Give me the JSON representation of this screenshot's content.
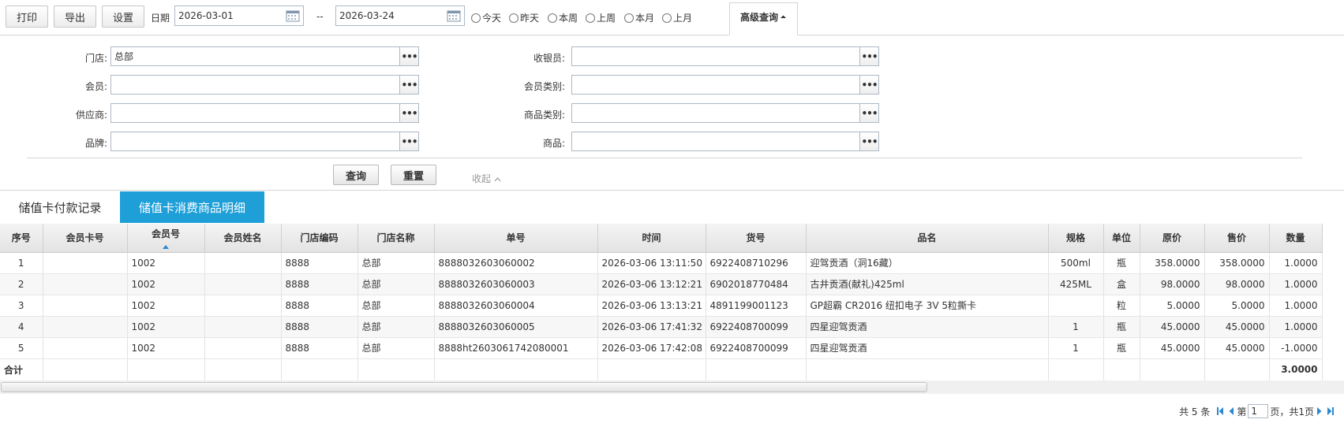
{
  "toolbar": {
    "print": "打印",
    "export": "导出",
    "settings": "设置",
    "date_label": "日期",
    "date_from": "2026-03-01",
    "date_sep": "--",
    "date_to": "2026-03-24",
    "quick_ranges": [
      "今天",
      "昨天",
      "本周",
      "上周",
      "本月",
      "上月"
    ],
    "advanced": "高级查询"
  },
  "filters": {
    "store_label": "门店:",
    "store_value": "总部",
    "cashier_label": "收银员:",
    "member_label": "会员:",
    "member_type_label": "会员类别:",
    "supplier_label": "供应商:",
    "goods_type_label": "商品类别:",
    "brand_label": "品牌:",
    "goods_label": "商品:",
    "more": "•••",
    "query": "查询",
    "reset": "重置",
    "collapse": "收起"
  },
  "tabs": [
    "储值卡付款记录",
    "储值卡消费商品明细"
  ],
  "grid": {
    "columns": [
      "序号",
      "会员卡号",
      "会员号",
      "会员姓名",
      "门店编码",
      "门店名称",
      "单号",
      "时间",
      "货号",
      "品名",
      "规格",
      "单位",
      "原价",
      "售价",
      "数量"
    ],
    "rows": [
      [
        "1",
        "",
        "1002",
        "",
        "8888",
        "总部",
        "8888032603060002",
        "2026-03-06 13:11:50",
        "6922408710296",
        "迎驾贡酒（洞16藏）",
        "500ml",
        "瓶",
        "358.0000",
        "358.0000",
        "1.0000"
      ],
      [
        "2",
        "",
        "1002",
        "",
        "8888",
        "总部",
        "8888032603060003",
        "2026-03-06 13:12:21",
        "6902018770484",
        "古井贡酒(献礼)425ml",
        "425ML",
        "盒",
        "98.0000",
        "98.0000",
        "1.0000"
      ],
      [
        "3",
        "",
        "1002",
        "",
        "8888",
        "总部",
        "8888032603060004",
        "2026-03-06 13:13:21",
        "4891199001123",
        "GP超霸 CR2016 纽扣电子 3V 5粒撕卡",
        "",
        "粒",
        "5.0000",
        "5.0000",
        "1.0000"
      ],
      [
        "4",
        "",
        "1002",
        "",
        "8888",
        "总部",
        "8888032603060005",
        "2026-03-06 17:41:32",
        "6922408700099",
        "四星迎驾贡酒",
        "1",
        "瓶",
        "45.0000",
        "45.0000",
        "1.0000"
      ],
      [
        "5",
        "",
        "1002",
        "",
        "8888",
        "总部",
        "8888ht2603061742080001",
        "2026-03-06 17:42:08",
        "6922408700099",
        "四星迎驾贡酒",
        "1",
        "瓶",
        "45.0000",
        "45.0000",
        "-1.0000"
      ]
    ],
    "total_label": "合计",
    "total_qty": "3.0000"
  },
  "pager": {
    "total": "共 5 条",
    "page_prefix": "第",
    "page_value": "1",
    "page_suffix": "页，共1页"
  }
}
